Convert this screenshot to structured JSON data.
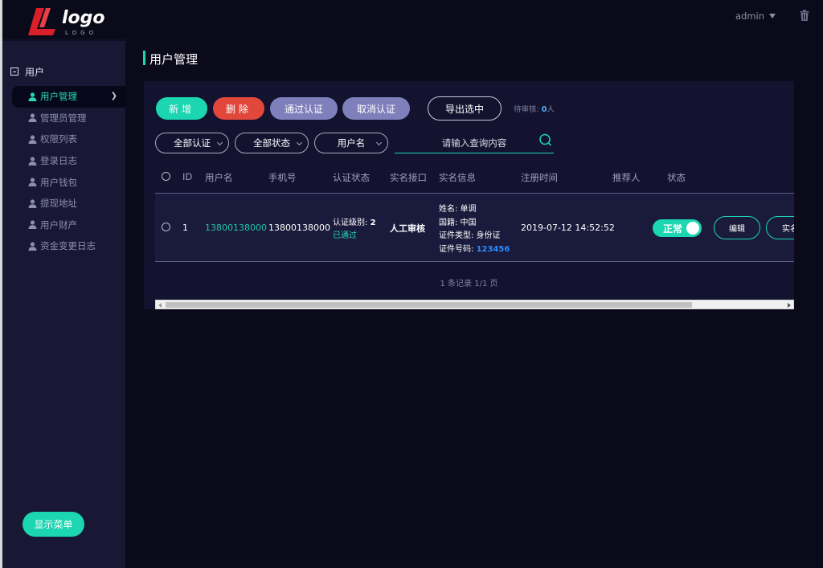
{
  "brand": {
    "logo_text": "logo",
    "logo_sub": "LOGO"
  },
  "header": {
    "user": "admin",
    "trash_icon": "trash-icon"
  },
  "sidebar": {
    "group_label": "用户",
    "items": [
      {
        "label": "用户管理",
        "active": true
      },
      {
        "label": "管理员管理"
      },
      {
        "label": "权限列表"
      },
      {
        "label": "登录日志"
      },
      {
        "label": "用户钱包"
      },
      {
        "label": "提现地址"
      },
      {
        "label": "用户财产"
      },
      {
        "label": "资金变更日志"
      }
    ],
    "show_menu_label": "显示菜单"
  },
  "page": {
    "title": "用户管理"
  },
  "toolbar": {
    "new_label": "新增",
    "delete_label": "删除",
    "pass_label": "通过认证",
    "cancel_label": "取消认证",
    "export_label": "导出选中",
    "pending_label": "待审核:",
    "pending_count": "0",
    "pending_unit": "人"
  },
  "filters": {
    "auth": "全部认证",
    "status": "全部状态",
    "field": "用户名",
    "search_placeholder": "请输入查询内容"
  },
  "table": {
    "headers": [
      "ID",
      "用户名",
      "手机号",
      "认证状态",
      "实名接口",
      "实名信息",
      "注册时间",
      "推荐人",
      "状态"
    ],
    "rows": [
      {
        "id": "1",
        "username": "13800138000",
        "phone": "13800138000",
        "auth_level_label": "认证级别:",
        "auth_level": "2",
        "auth_state": "已通过",
        "api": "人工审核",
        "info_name": "姓名: 单调",
        "info_nation": "国籍: 中国",
        "info_doc_type": "证件类型: 身份证",
        "info_doc_label": "证件号码:",
        "info_doc_no": "123456",
        "registered": "2019-07-12 14:52:52",
        "referrer": "",
        "status": "正常",
        "edit_label": "编辑",
        "real_label": "实名"
      }
    ]
  },
  "pager": {
    "text": "1 条记录 1/1 页"
  },
  "colors": {
    "accent": "#1bd6b0",
    "danger": "#e2473b",
    "muted_button": "#7f7fbc",
    "link_blue": "#2c8cff"
  }
}
